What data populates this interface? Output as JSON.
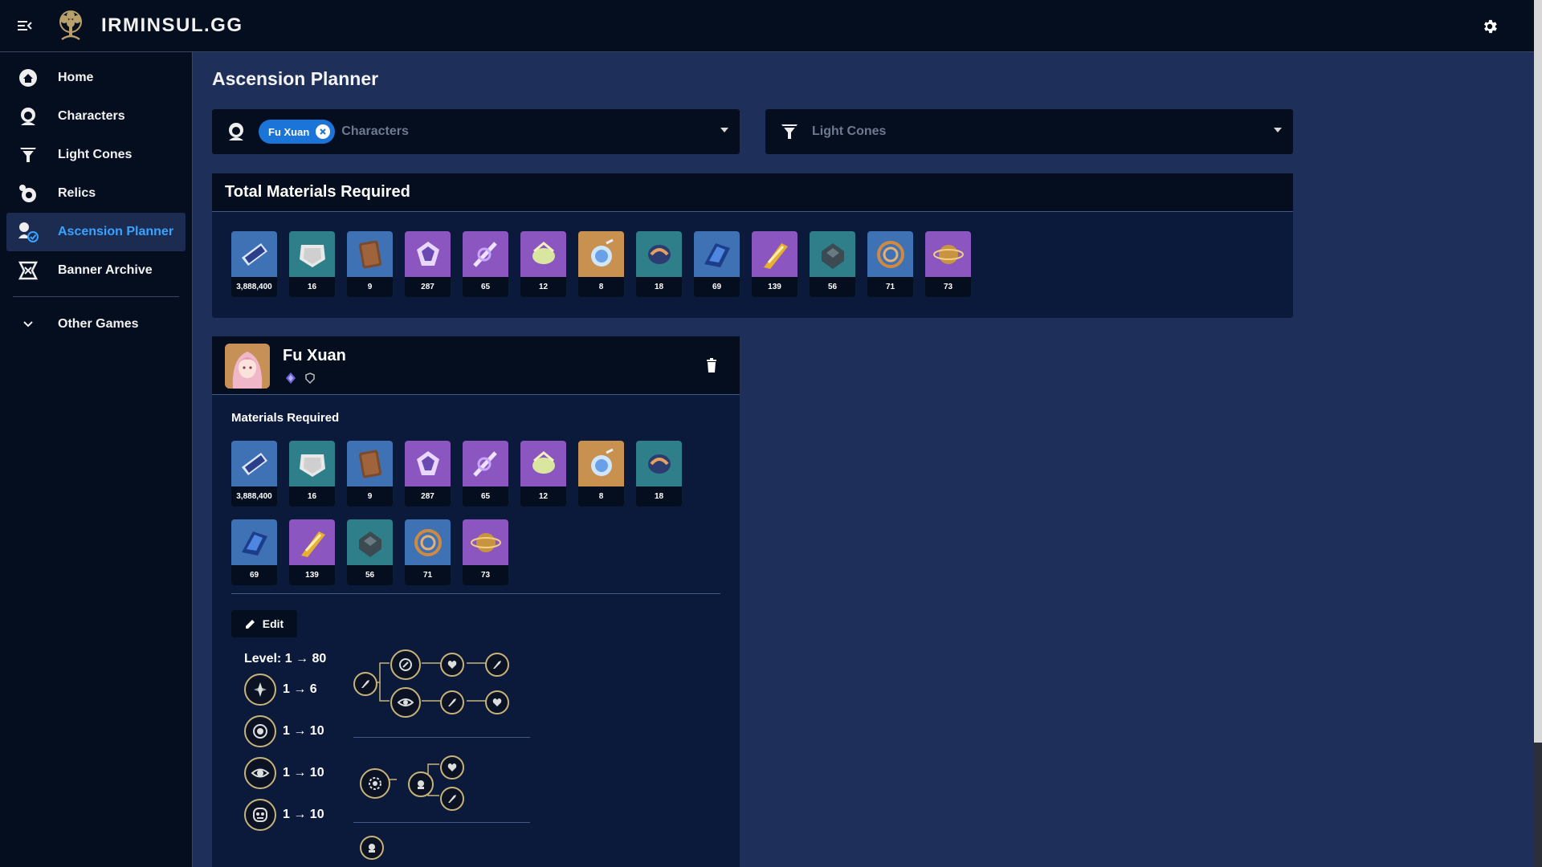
{
  "app": {
    "brand": "IRMINSUL.GG"
  },
  "sidebar": {
    "items": [
      {
        "label": "Home",
        "icon": "home-icon"
      },
      {
        "label": "Characters",
        "icon": "characters-icon"
      },
      {
        "label": "Light Cones",
        "icon": "light-cones-icon"
      },
      {
        "label": "Relics",
        "icon": "relics-icon"
      },
      {
        "label": "Ascension Planner",
        "icon": "ascension-planner-icon",
        "active": true
      },
      {
        "label": "Banner Archive",
        "icon": "banner-archive-icon"
      }
    ],
    "other_games": "Other Games"
  },
  "page": {
    "title": "Ascension Planner"
  },
  "selectors": {
    "characters": {
      "chip": "Fu Xuan",
      "placeholder": "Characters"
    },
    "light_cones": {
      "placeholder": "Light Cones"
    }
  },
  "total": {
    "title": "Total Materials Required",
    "materials": [
      {
        "count": "3,888,400",
        "color": "blue"
      },
      {
        "count": "16",
        "color": "teal"
      },
      {
        "count": "9",
        "color": "blue"
      },
      {
        "count": "287",
        "color": "purple"
      },
      {
        "count": "65",
        "color": "purple"
      },
      {
        "count": "12",
        "color": "purple"
      },
      {
        "count": "8",
        "color": "gold"
      },
      {
        "count": "18",
        "color": "teal"
      },
      {
        "count": "69",
        "color": "blue"
      },
      {
        "count": "139",
        "color": "purple"
      },
      {
        "count": "56",
        "color": "teal"
      },
      {
        "count": "71",
        "color": "blue"
      },
      {
        "count": "73",
        "color": "purple"
      }
    ]
  },
  "character": {
    "name": "Fu Xuan",
    "materials_title": "Materials Required",
    "edit_label": "Edit",
    "level": "Level: 1 → 80",
    "skills": [
      {
        "range": "1 → 6",
        "icon": "basic-attack-icon"
      },
      {
        "range": "1 → 10",
        "icon": "skill-icon"
      },
      {
        "range": "1 → 10",
        "icon": "ultimate-icon"
      },
      {
        "range": "1 → 10",
        "icon": "talent-icon"
      }
    ]
  },
  "colors": {
    "accent": "#3aa2ff",
    "chip": "#1b74d8",
    "sidebar_bg": "#050e1f",
    "main_bg": "#1e3059",
    "node_border": "#c8b47a"
  }
}
